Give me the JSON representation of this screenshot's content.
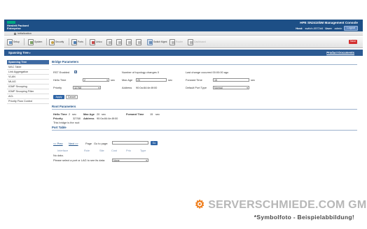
{
  "header": {
    "logo_lines": [
      "Hewlett Packard",
      "Enterprise"
    ],
    "title": "HPE SN2410bM Management Console",
    "host_label": "Host:",
    "host_value": "switch-0572d4",
    "user_label": "User:",
    "user_value": "admin",
    "logout_label": "Logout"
  },
  "tabstrip": {
    "tab_label": "Initialization"
  },
  "toolbar": {
    "items": [
      {
        "label": "Setup",
        "icon": "setup-icon"
      },
      {
        "label": "System",
        "icon": "system-icon"
      },
      {
        "label": "Security",
        "icon": "security-icon"
      },
      {
        "label": "Ports",
        "icon": "ports-icon"
      },
      {
        "label": "Unico",
        "icon": "unico-icon"
      },
      {
        "label": "Switch Mgmt",
        "icon": "switch-mgmt-icon"
      },
      {
        "label": "Router",
        "icon": "router-icon"
      },
      {
        "label": "Dashboard",
        "icon": "dashboard-icon"
      }
    ],
    "save_label": "Save"
  },
  "subbar": {
    "title": "Spanning Tree",
    "link": "Product Documents"
  },
  "sidebar": {
    "items": [
      {
        "label": "Spanning Tree",
        "active": true
      },
      {
        "label": "MAC Table"
      },
      {
        "label": "Link Aggregation"
      },
      {
        "label": "VLAN"
      },
      {
        "label": "MLAG"
      },
      {
        "label": "IGMP Snooping"
      },
      {
        "label": "IGMP Snooping Filter"
      },
      {
        "label": "ACL"
      },
      {
        "label": "Priority Flow Control"
      }
    ]
  },
  "bridge": {
    "title": "Bridge Parameters",
    "rstp_label": "RST Enabled",
    "rstp_checked": "✓",
    "topology_label": "Number of topology changes 0",
    "last_change_label": "Last change occurred 00:00:00 ago",
    "hello_label": "Hello Time",
    "hello_value": "2",
    "hello_unit": "sec",
    "maxage_label": "Max Age",
    "maxage_value": "20",
    "maxage_unit": "sec",
    "forward_label": "Forward Time",
    "forward_value": "15",
    "forward_unit": "sec",
    "priority_label": "Priority",
    "priority_value": "32768",
    "address_label": "Address",
    "address_value": "90:0a:84:4e:8f:00",
    "port_type_label": "Default Port Type",
    "port_type_value": "Normal",
    "apply_label": "Apply",
    "cancel_label": "Cancel"
  },
  "root": {
    "title": "Root Parameters",
    "hello_label": "Hello Time",
    "hello_value": "2",
    "hello_unit": "sec",
    "maxage_label": "Max Age",
    "maxage_value": "20",
    "maxage_unit": "sec",
    "forward_label": "Forward Time",
    "forward_value": "15",
    "forward_unit": "sec",
    "priority_label": "Priority",
    "priority_value": "32768",
    "address_label": "Address",
    "address_value": "90:0a:84:4e:8f:00",
    "bridge_root_text": "This bridge is the root"
  },
  "port_table": {
    "title": "Port Table",
    "prev_label": "<< Prev",
    "next_label": "Next >>",
    "page_label": "Page",
    "goto_label": "Go to page:",
    "go_label": "Go",
    "columns": [
      "Interface",
      "Role",
      "Site",
      "Cost",
      "Prio",
      "Type"
    ],
    "no_data": "No data.",
    "select_prompt": "Please select a port or LAG to see its data:",
    "select_value": "None"
  },
  "watermark": {
    "brand": "SERVERSCHMIEDE.COM GMBH",
    "subtitle": "*Symbolfoto - Beispielabbildung!"
  },
  "colors": {
    "header_bg": "#1d4f86",
    "subbar_bg": "#2c5a92",
    "accent": "#3e6aa3",
    "save": "#d32f2f",
    "hpe_green": "#01a982",
    "watermark_gear": "#ef7d1b"
  }
}
